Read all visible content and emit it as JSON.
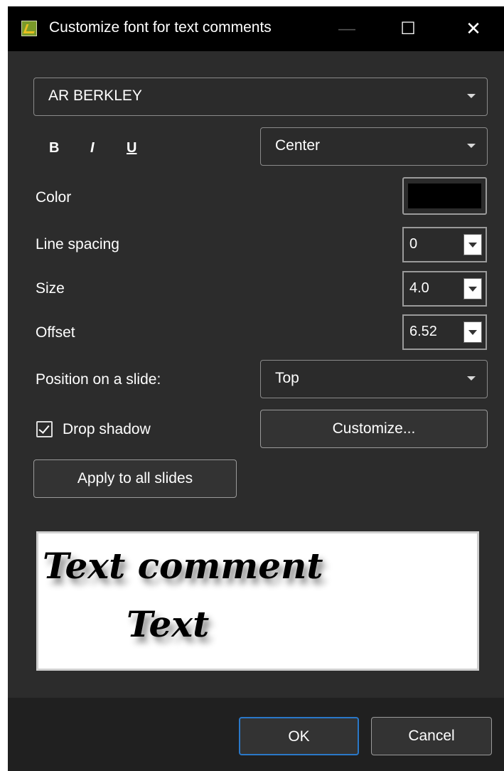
{
  "window": {
    "title": "Customize font for text comments"
  },
  "titlebar": {
    "minimize": "—",
    "maximize": "☐",
    "close": "✕"
  },
  "font": {
    "selected": "AR BERKLEY"
  },
  "format": {
    "bold": "B",
    "italic": "I",
    "underline": "U"
  },
  "alignment": {
    "selected": "Center"
  },
  "color": {
    "label": "Color",
    "value": "#000000"
  },
  "line_spacing": {
    "label": "Line spacing",
    "value": "0"
  },
  "size": {
    "label": "Size",
    "value": "4.0"
  },
  "offset": {
    "label": "Offset",
    "value": "6.52"
  },
  "position": {
    "label": "Position on a slide:",
    "selected": "Top"
  },
  "drop_shadow": {
    "label": "Drop shadow",
    "checked": true
  },
  "customize": {
    "label": "Customize..."
  },
  "apply_all": {
    "label": "Apply to all slides"
  },
  "preview": {
    "line1": "Text comment",
    "line2": "Text"
  },
  "buttons": {
    "ok": "OK",
    "cancel": "Cancel"
  }
}
